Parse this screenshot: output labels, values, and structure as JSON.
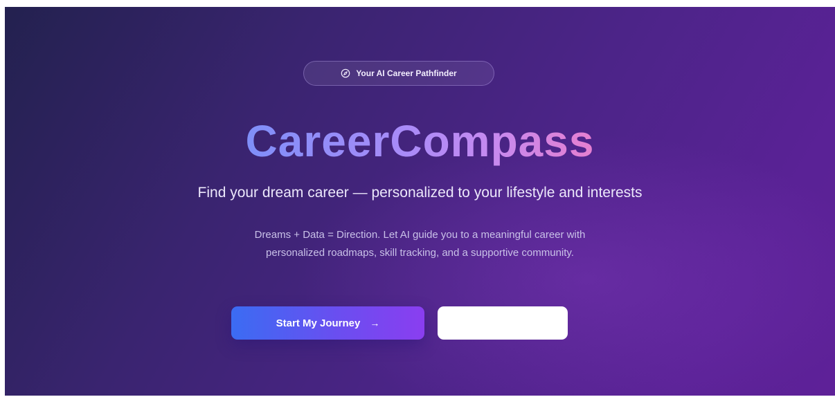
{
  "hero": {
    "badge_label": "Your AI Career Pathfinder",
    "badge_icon": "compass-icon",
    "title": "CareerCompass",
    "subtitle": "Find your dream career — personalized to your lifestyle and interests",
    "description_lines": [
      "Dreams + Data = Direction. Let AI guide you to a meaningful career with",
      "personalized roadmaps, skill tracking, and a supportive community."
    ]
  },
  "actions": {
    "primary_label": "Start My Journey",
    "primary_icon": "arrow-right-icon",
    "primary_arrow": "→",
    "secondary_label": ""
  },
  "colors": {
    "background_start": "#23214f",
    "background_end": "#5e2198",
    "title_gradient_start": "#7f8ff8",
    "title_gradient_end": "#e67fd0",
    "primary_button_start": "#3b6cf3",
    "primary_button_end": "#8a3ef0"
  }
}
